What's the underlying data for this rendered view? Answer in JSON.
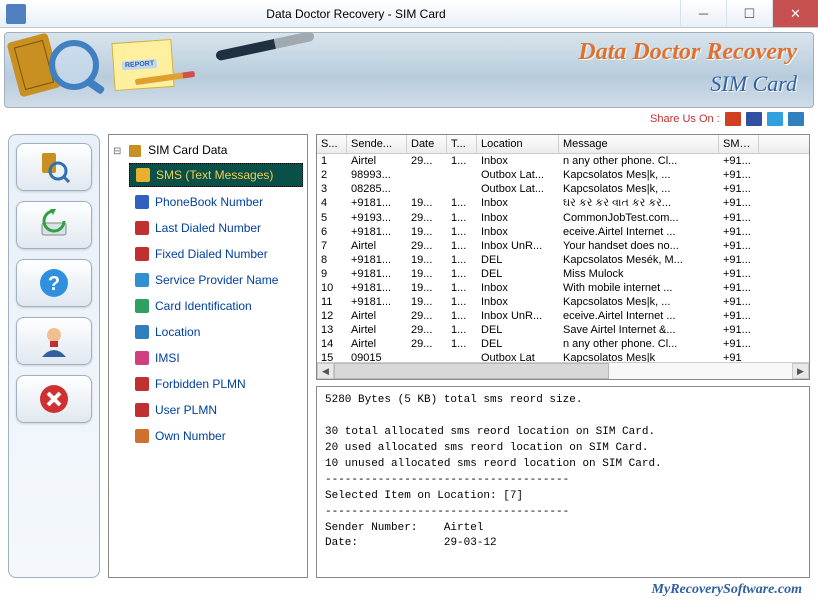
{
  "window": {
    "title": "Data Doctor Recovery - SIM Card"
  },
  "banner": {
    "title": "Data Doctor Recovery",
    "subtitle": "SIM Card"
  },
  "share": {
    "label": "Share Us On :"
  },
  "tree": {
    "root": "SIM Card Data",
    "items": [
      {
        "label": "SMS (Text Messages)",
        "icon": "envelope",
        "selected": true
      },
      {
        "label": "PhoneBook Number",
        "icon": "phonebook"
      },
      {
        "label": "Last Dialed Number",
        "icon": "lastdial"
      },
      {
        "label": "Fixed Dialed Number",
        "icon": "fixeddial"
      },
      {
        "label": "Service Provider Name",
        "icon": "antenna"
      },
      {
        "label": "Card Identification",
        "icon": "card"
      },
      {
        "label": "Location",
        "icon": "globe"
      },
      {
        "label": "IMSI",
        "icon": "imsi"
      },
      {
        "label": "Forbidden PLMN",
        "icon": "forbidden"
      },
      {
        "label": "User PLMN",
        "icon": "userplmn"
      },
      {
        "label": "Own Number",
        "icon": "own"
      }
    ]
  },
  "table": {
    "columns": [
      "S...",
      "Sende...",
      "Date",
      "T...",
      "Location",
      "Message",
      "SMS..."
    ],
    "rows": [
      [
        "1",
        "Airtel",
        "29...",
        "1...",
        "Inbox",
        "n any other phone. Cl...",
        "+91..."
      ],
      [
        "2",
        "98993...",
        "",
        "",
        "Outbox Lat...",
        "Kapcsolatos Mes|k, ...",
        "+91..."
      ],
      [
        "3",
        "08285...",
        "",
        "",
        "Outbox Lat...",
        "Kapcsolatos Mes|k, ...",
        "+91..."
      ],
      [
        "4",
        "+9181...",
        "19...",
        "1...",
        "Inbox",
        "ઘર કર કર વાત કર કર...",
        "+91..."
      ],
      [
        "5",
        "+9193...",
        "29...",
        "1...",
        "Inbox",
        "CommonJobTest.com...",
        "+91..."
      ],
      [
        "6",
        "+9181...",
        "19...",
        "1...",
        "Inbox",
        "eceive.Airtel Internet ...",
        "+91..."
      ],
      [
        "7",
        "Airtel",
        "29...",
        "1...",
        "Inbox UnR...",
        "Your handset does no...",
        "+91..."
      ],
      [
        "8",
        "+9181...",
        "19...",
        "1...",
        "DEL",
        "Kapcsolatos Mesék, M...",
        "+91..."
      ],
      [
        "9",
        "+9181...",
        "19...",
        "1...",
        "DEL",
        " Miss Mulock",
        "+91..."
      ],
      [
        "10",
        "+9181...",
        "19...",
        "1...",
        "Inbox",
        "With mobile internet ...",
        "+91..."
      ],
      [
        "11",
        "+9181...",
        "19...",
        "1...",
        "Inbox",
        "Kapcsolatos Mes|k, ...",
        "+91..."
      ],
      [
        "12",
        "Airtel",
        "29...",
        "1...",
        "Inbox UnR...",
        "eceive.Airtel Internet ...",
        "+91..."
      ],
      [
        "13",
        "Airtel",
        "29...",
        "1...",
        "DEL",
        "Save Airtel Internet &...",
        "+91..."
      ],
      [
        "14",
        "Airtel",
        "29...",
        "1...",
        "DEL",
        "n any other phone. Cl...",
        "+91..."
      ],
      [
        "15",
        "09015",
        "",
        "",
        "Outbox Lat",
        "Kapcsolatos Mes|k",
        "+91"
      ]
    ]
  },
  "details": {
    "line1": "5280 Bytes (5 KB) total sms reord size.",
    "line2": "30 total allocated sms reord location on SIM Card.",
    "line3": "20 used allocated sms reord location on SIM Card.",
    "line4": "10 unused allocated sms reord location on SIM Card.",
    "sep": "-------------------------------------",
    "sel": "Selected Item on Location: [7]",
    "senderlbl": "Sender Number:",
    "sender": "Airtel",
    "datelbl": "Date:",
    "date": "29-03-12"
  },
  "footer": {
    "url": "MyRecoverySoftware.com"
  }
}
